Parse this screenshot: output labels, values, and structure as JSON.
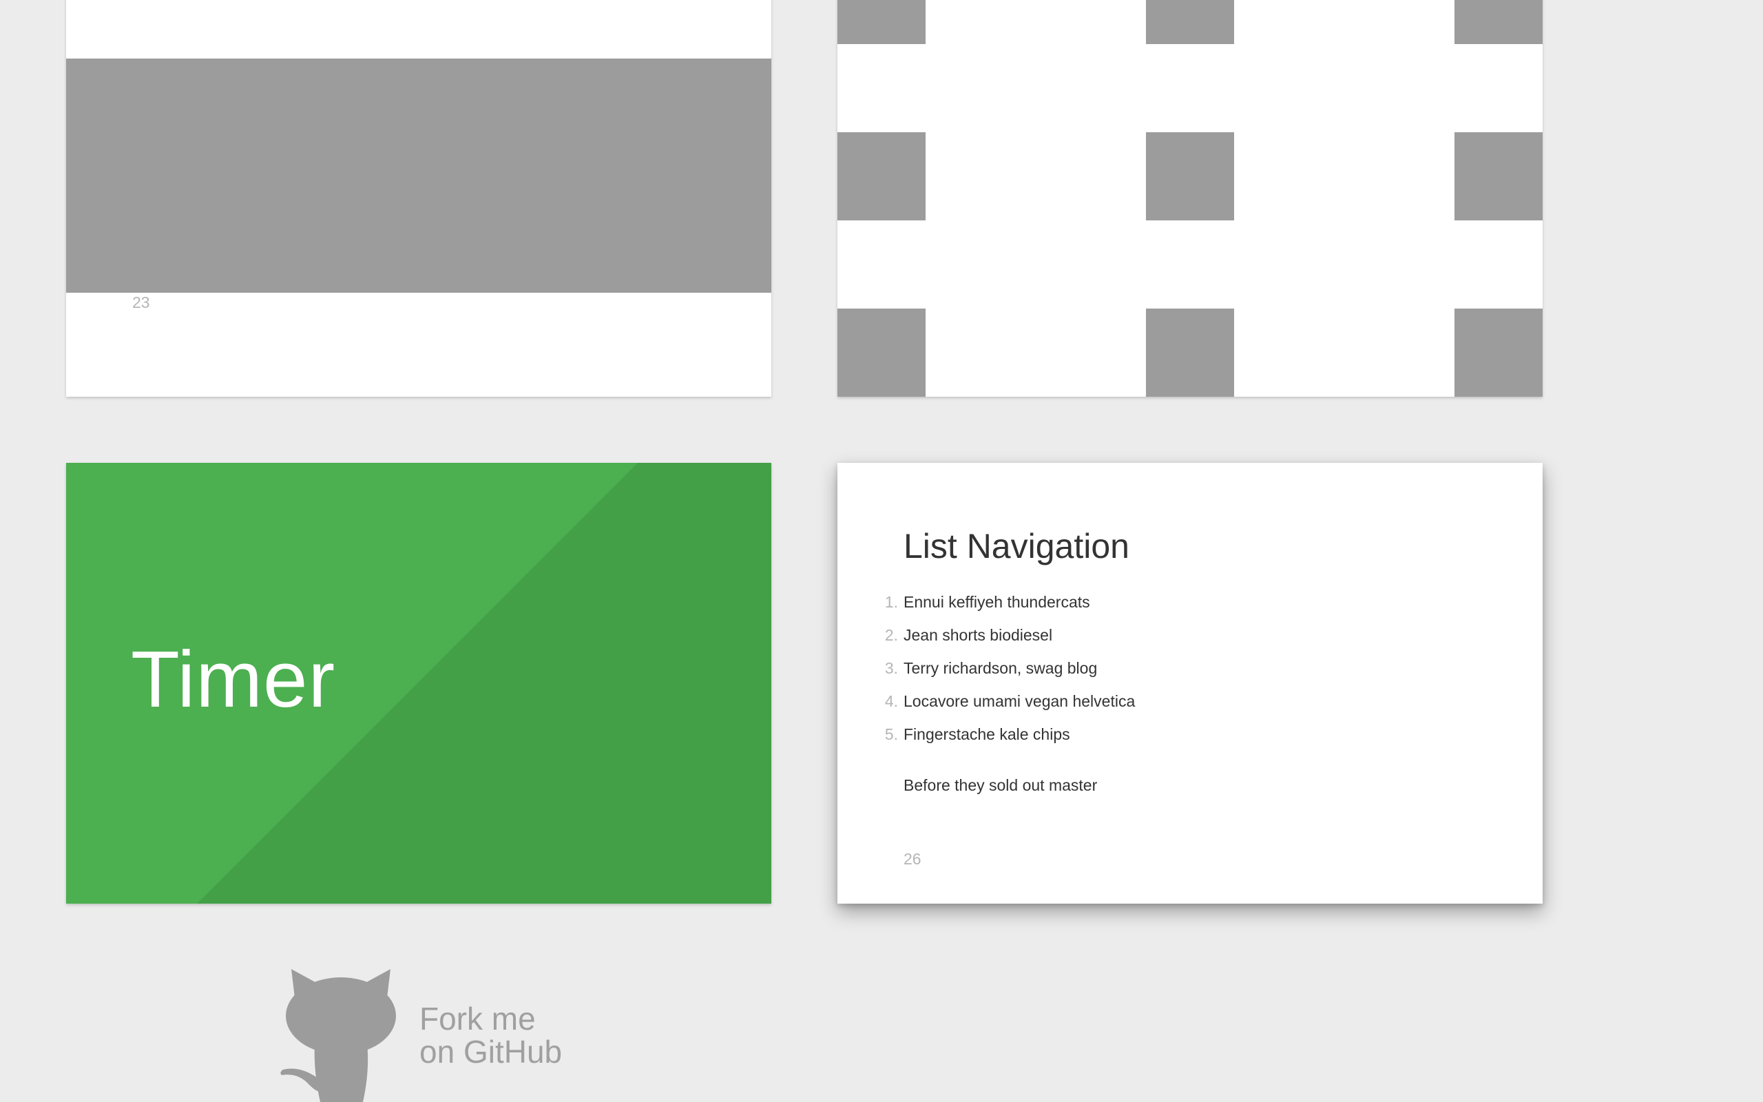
{
  "slides": {
    "slide23": {
      "number": "23"
    },
    "slide25": {
      "title": "Timer"
    },
    "slide26": {
      "title": "List Navigation",
      "items": [
        {
          "num": "1.",
          "text": "Ennui keffiyeh thundercats"
        },
        {
          "num": "2.",
          "text": "Jean shorts biodiesel"
        },
        {
          "num": "3.",
          "text": "Terry richardson, swag blog"
        },
        {
          "num": "4.",
          "text": "Locavore umami vegan helvetica"
        },
        {
          "num": "5.",
          "text": "Fingerstache kale chips"
        }
      ],
      "after_text": "Before they sold out master",
      "number": "26"
    }
  },
  "github": {
    "line1": "Fork me",
    "line2": "on GitHub",
    "icon": "octocat-icon"
  },
  "colors": {
    "background": "#ececec",
    "placeholder_gray": "#9c9c9c",
    "timer_green": "#4caf50",
    "timer_green_dark": "#43a047",
    "slide_number": "#b5b5b5",
    "fork_text": "#a0a0a0"
  }
}
